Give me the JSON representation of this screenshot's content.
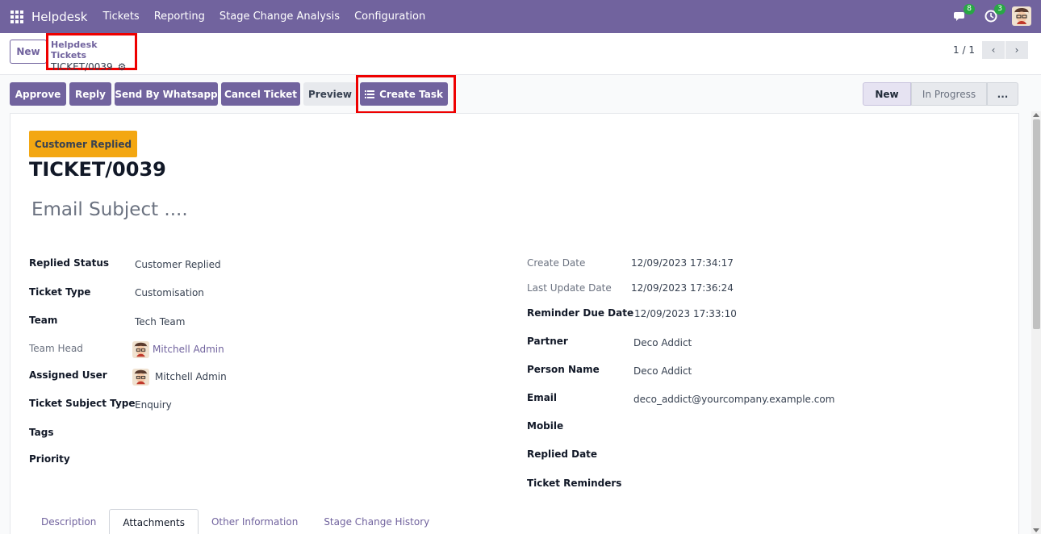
{
  "navbar": {
    "brand": "Helpdesk",
    "menu": [
      "Tickets",
      "Reporting",
      "Stage Change Analysis",
      "Configuration"
    ],
    "messages_count": "8",
    "activities_count": "3",
    "color": "#71639e"
  },
  "control_panel": {
    "new_label": "New",
    "breadcrumb_parent": "Helpdesk Tickets",
    "breadcrumb_current": "TICKET/0039",
    "pager_value": "1 / 1"
  },
  "statusbar": {
    "buttons": [
      "Approve",
      "Reply",
      "Send By Whatsapp",
      "Cancel Ticket",
      "Preview",
      "Create Task"
    ],
    "stages": [
      "New",
      "In Progress",
      "..."
    ]
  },
  "sheet": {
    "ribbon": "Customer Replied",
    "ribbon_color": "#f3a712",
    "name": "TICKET/0039",
    "email_subject_placeholder": "Email Subject ....",
    "left_fields": [
      {
        "label": "Replied Status",
        "value": "Customer Replied"
      },
      {
        "label": "Ticket Type",
        "value": "Customisation"
      },
      {
        "label": "Team",
        "value": "Tech Team"
      },
      {
        "label": "Team Head",
        "value": "Mitchell Admin"
      },
      {
        "label": "Assigned User",
        "value": "Mitchell Admin"
      },
      {
        "label": "Ticket Subject Type",
        "value": "Enquiry"
      },
      {
        "label": "Tags",
        "value": ""
      },
      {
        "label": "Priority",
        "value": ""
      }
    ],
    "right_fields": [
      {
        "label": "Create Date",
        "value": "12/09/2023 17:34:17"
      },
      {
        "label": "Last Update Date",
        "value": "12/09/2023 17:36:24"
      },
      {
        "label": "Reminder Due Date",
        "value": "12/09/2023 17:33:10"
      },
      {
        "label": "Partner",
        "value": "Deco Addict"
      },
      {
        "label": "Person Name",
        "value": "Deco Addict"
      },
      {
        "label": "Email",
        "value": "deco_addict@yourcompany.example.com"
      },
      {
        "label": "Mobile",
        "value": ""
      },
      {
        "label": "Replied Date",
        "value": ""
      },
      {
        "label": "Ticket Reminders",
        "value": ""
      }
    ],
    "tabs": [
      "Description",
      "Attachments",
      "Other Information",
      "Stage Change History"
    ],
    "active_tab": "Attachments"
  }
}
